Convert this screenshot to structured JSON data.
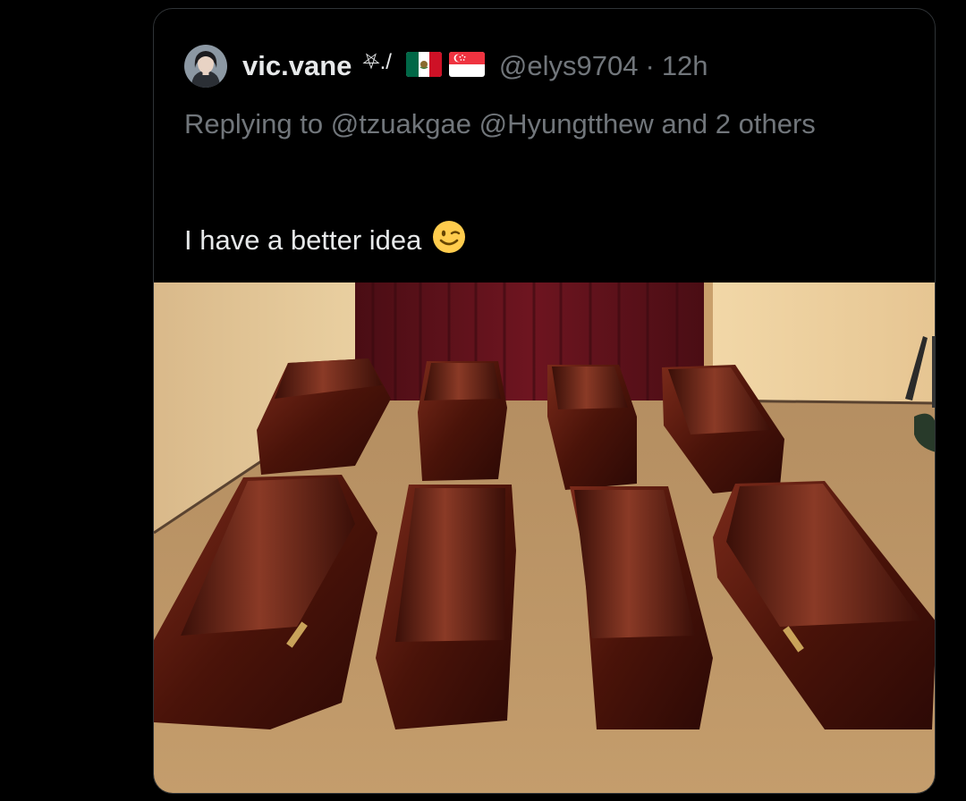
{
  "tweet": {
    "author": {
      "display_name": "vic.vane",
      "decoration": "⛧./",
      "flag_icons": [
        "mexico-flag-icon",
        "singapore-flag-icon"
      ],
      "handle": "@elys9704"
    },
    "separator": "·",
    "time": "12h",
    "reply_prefix": "Replying to ",
    "reply_users": [
      "@tzuakgae",
      "@Hyungtthew"
    ],
    "reply_suffix": " and 2 others",
    "text": "I have a better idea",
    "emoji": "winking-face-emoji",
    "media": {
      "alt_icon": "coffins-photo",
      "description_visible": false
    }
  },
  "colors": {
    "background": "#000000",
    "card_border": "#2f3336",
    "primary_text": "#e7e9ea",
    "secondary_text": "#71767b"
  }
}
